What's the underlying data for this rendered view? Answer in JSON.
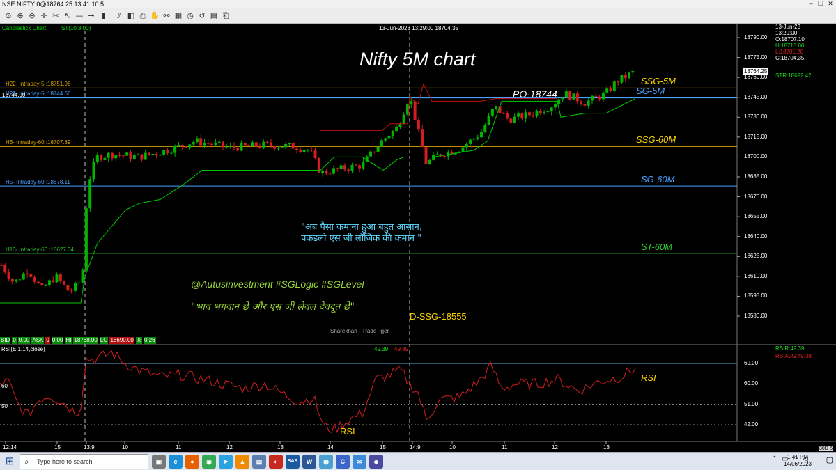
{
  "window": {
    "title": "NSE.NIFTY 0@18764.25 13:41:10 5"
  },
  "toolbar": {
    "icons": [
      "zoom-fit-icon",
      "zoom-in-icon",
      "zoom-out-icon",
      "crosshair-icon",
      "drag-icon",
      "pointer-icon",
      "line-icon",
      "ray-icon",
      "bar-chart-icon",
      "trend-icon",
      "cube-icon",
      "print-icon",
      "hand-icon",
      "link-icon",
      "table-icon",
      "clock-icon",
      "undo-icon",
      "calendar-icon",
      "save-icon"
    ]
  },
  "chart": {
    "type_label": "Candlestick Chart",
    "indicator_label": "ST(10,3.00)",
    "header_info": "13-Jun-2023  13:29:00  18704.35",
    "main_title": "Nifty 5M chart",
    "ohlc": {
      "date": "13-Jun-23",
      "time": "13:29:00",
      "open": "O:18707.10",
      "high": "H:18713.00",
      "low": "L:18701.20",
      "close": "C:18704.35"
    },
    "last_price": "18764.25",
    "str_value": "STR:18692.42",
    "price_ticks": [
      "18790.00",
      "18775.00",
      "18760.00",
      "18745.00",
      "18730.00",
      "18715.00",
      "18700.00",
      "18685.00",
      "18670.00",
      "18655.00",
      "18640.00",
      "18625.00",
      "18610.00",
      "18595.00",
      "18580.00"
    ],
    "levels": [
      {
        "text": "H22- Intraday-5 :18751.98",
        "tag": "SSG-5M",
        "color": "#d8a400",
        "tagcolor": "#f5d000"
      },
      {
        "text": "H21- Intraday-5 :18744.66",
        "tag": "SG-5M",
        "color": "#4aa0ff",
        "tagcolor": "#4aa0ff",
        "cursor": "18744.00"
      },
      {
        "text": "H6- Intraday-60 :18707.89",
        "tag": "SSG-60M",
        "color": "#d8a400",
        "tagcolor": "#f5d000"
      },
      {
        "text": "H5- Intraday-60 :18678.11",
        "tag": "SG-60M",
        "color": "#4aa0ff",
        "tagcolor": "#4aa0ff"
      },
      {
        "text": "H13- Intraday-60 :18627.34",
        "tag": "ST-60M",
        "color": "#2ec82e",
        "tagcolor": "#2ec82e"
      }
    ],
    "annotations": {
      "po": "PO-18744",
      "dssg": "D-SSG-18555",
      "hindi_quote_1": "\"अब पैसा कमाना हुआ बहुत आसान,",
      "hindi_quote_2": "पकडलो एस जी लॉजिक की कमान \"",
      "handles": "@Autusinvestment  #SGLogic  #SGLevel",
      "hindi_quote_3": "\"भाव भगवान छे और एस जी लेवल देवदूत छे\"",
      "watermark": "Sharekhan - TradeTiger"
    },
    "ticker": [
      {
        "label": "BID",
        "value": "0"
      },
      {
        "label": "",
        "value": "0.00"
      },
      {
        "label": "ASK",
        "value": "0"
      },
      {
        "label": "",
        "value": "0.00"
      },
      {
        "label": "HI",
        "value": "18768.00"
      },
      {
        "label": "LO",
        "value": "18690.00"
      },
      {
        "label": "%",
        "value": "0.26"
      }
    ],
    "rsi": {
      "label": "RSI(E,1,14,close)",
      "value1": "49.39",
      "value2": "49.39",
      "rsir": "RSIR:49.39",
      "rsiavg": "RSIAVG:49.39",
      "ticks": [
        "69.00",
        "60.00",
        "51.00",
        "42.00"
      ],
      "left_ticks": [
        "60",
        "50"
      ],
      "tag_right": "RSI",
      "tag_bottom": "RSI"
    },
    "time_axis": [
      "12:14",
      "15",
      "13:9",
      "10",
      "11",
      "12",
      "13",
      "14",
      "15",
      "14:9",
      "10",
      "11",
      "12",
      "13"
    ],
    "corner": "30D-5"
  },
  "taskbar": {
    "search_placeholder": "Type here to search",
    "apps": [
      "task-view",
      "edge",
      "firefox",
      "chrome",
      "telegram",
      "vlc",
      "notepad",
      "tradetiger",
      "sas",
      "word",
      "app-globe",
      "app-c",
      "app-mail",
      "app-shield"
    ],
    "time": "1:41 PM",
    "date": "14/06/2023"
  },
  "colors": {
    "up": "#00b400",
    "down": "#d21e1e",
    "supertrend": "#00c800",
    "resistance": "#c01010"
  }
}
